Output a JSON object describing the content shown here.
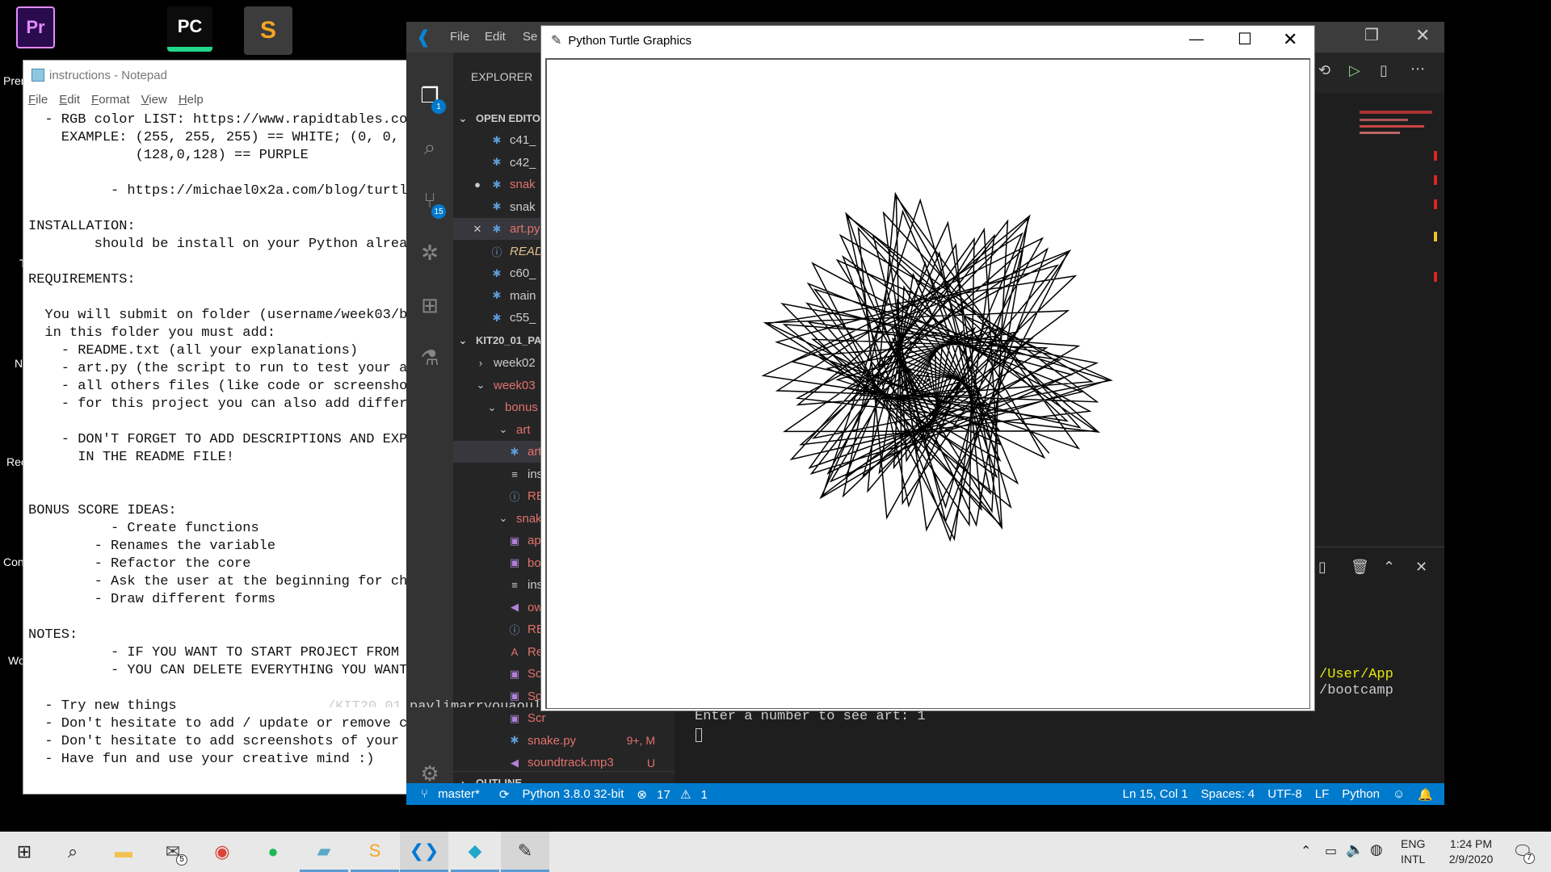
{
  "desktop": {
    "icons": [
      {
        "name": "premiere-icon",
        "glyph": "Pr",
        "color": "#2a0c4e",
        "accent": "#e48bff"
      },
      {
        "name": "pycharm-icon",
        "glyph": "PC",
        "color": "#0c0c0c",
        "accent": "#21d789"
      },
      {
        "name": "sublime-icon",
        "glyph": "S",
        "color": "#f5a623",
        "accent": "#fff"
      }
    ],
    "labels": [
      "Pren",
      "T",
      "N",
      "Rec",
      "Con",
      "Wo"
    ]
  },
  "notepad": {
    "title": "instructions - Notepad",
    "menu": [
      "File",
      "Edit",
      "Format",
      "View",
      "Help"
    ],
    "text": "  - RGB color LIST: https://www.rapidtables.com\n    EXAMPLE: (255, 255, 255) == WHITE; (0, 0, 0\n             (128,0,128) == PURPLE\n\n          - https://michael0x2a.com/blog/turtle-e\n\nINSTALLATION:\n        should be install on your Python alread\n\nREQUIREMENTS:\n\n  You will submit on folder (username/week03/bo\n  in this folder you must add:\n    - README.txt (all your explanations)\n    - art.py (the script to run to test your ap\n    - all others files (like code or screenshot\n    - for this project you can also add differe\n\n    - DON'T FORGET TO ADD DESCRIPTIONS AND EXPL\n      IN THE README FILE!\n\n\nBONUS SCORE IDEAS:\n          - Create functions\n        - Renames the variable\n        - Refactor the core\n        - Ask the user at the beginning for choic\n        - Draw different forms\n\nNOTES:\n          - IF YOU WANT TO START PROJECT FROM SCR\n          - YOU CAN DELETE EVERYTHING YOU WANT.\n\n  - Try new things\n  - Don't hesitate to add / update or remove co\n  - Don't hesitate to add screenshots of your e\n  - Have fun and use your creative mind :)"
  },
  "vscode": {
    "menu": [
      "File",
      "Edit",
      "Se"
    ],
    "explorer_label": "EXPLORER",
    "open_editors_label": "OPEN EDITO",
    "open_editors": [
      {
        "label": "c41_",
        "prefix": "",
        "icon": "python-file-icon",
        "color": "#ccc",
        "italic": false
      },
      {
        "label": "c42_",
        "prefix": "",
        "icon": "python-file-icon",
        "color": "#ccc",
        "italic": false
      },
      {
        "label": "snak",
        "prefix": "●",
        "icon": "python-file-icon",
        "color": "#e2726c",
        "italic": false
      },
      {
        "label": "snak",
        "prefix": "",
        "icon": "python-file-icon",
        "color": "#ccc",
        "italic": false
      },
      {
        "label": "art.py",
        "prefix": "✕",
        "icon": "python-file-icon",
        "color": "#e2726c",
        "italic": false
      },
      {
        "label": "READ",
        "prefix": "",
        "icon": "info-file-icon",
        "color": "#e2c08d",
        "italic": true
      },
      {
        "label": "c60_",
        "prefix": "",
        "icon": "python-file-icon",
        "color": "#ccc",
        "italic": false
      },
      {
        "label": "main",
        "prefix": "",
        "icon": "python-file-icon",
        "color": "#ccc",
        "italic": false
      },
      {
        "label": "c55_",
        "prefix": "",
        "icon": "python-file-icon",
        "color": "#ccc",
        "italic": false
      }
    ],
    "workspace_label": "KIT20_01_PA",
    "tree": [
      {
        "label": "week02",
        "indent": 1,
        "chev": "›",
        "icon": "",
        "color": "#ccc"
      },
      {
        "label": "week03",
        "indent": 1,
        "chev": "⌄",
        "icon": "",
        "color": "#e2726c"
      },
      {
        "label": "bonus",
        "indent": 2,
        "chev": "⌄",
        "icon": "",
        "color": "#e2726c"
      },
      {
        "label": "art",
        "indent": 3,
        "chev": "⌄",
        "icon": "",
        "color": "#e2726c"
      },
      {
        "label": "art.",
        "indent": 4,
        "chev": "",
        "icon": "python-file-icon",
        "color": "#e2726c"
      },
      {
        "label": "inst",
        "indent": 4,
        "chev": "",
        "icon": "text-file-icon",
        "color": "#ccc"
      },
      {
        "label": "RE/",
        "indent": 4,
        "chev": "",
        "icon": "info-file-icon",
        "color": "#e2726c"
      },
      {
        "label": "snak",
        "indent": 3,
        "chev": "⌄",
        "icon": "",
        "color": "#e2726c"
      },
      {
        "label": "app",
        "indent": 4,
        "chev": "",
        "icon": "image-file-icon",
        "color": "#e2726c"
      },
      {
        "label": "bor",
        "indent": 4,
        "chev": "",
        "icon": "image-file-icon",
        "color": "#e2726c"
      },
      {
        "label": "inst",
        "indent": 4,
        "chev": "",
        "icon": "text-file-icon",
        "color": "#ccc"
      },
      {
        "label": "ow",
        "indent": 4,
        "chev": "",
        "icon": "audio-file-icon",
        "color": "#e2726c"
      },
      {
        "label": "RE/",
        "indent": 4,
        "chev": "",
        "icon": "info-file-icon",
        "color": "#e2726c"
      },
      {
        "label": "Ret",
        "indent": 4,
        "chev": "",
        "icon": "font-file-icon",
        "color": "#e2726c"
      },
      {
        "label": "Scr",
        "indent": 4,
        "chev": "",
        "icon": "image-file-icon",
        "color": "#e2726c"
      },
      {
        "label": "Scr",
        "indent": 4,
        "chev": "",
        "icon": "image-file-icon",
        "color": "#e2726c"
      },
      {
        "label": "Scr",
        "indent": 4,
        "chev": "",
        "icon": "image-file-icon",
        "color": "#e2726c"
      },
      {
        "label": "snake.py",
        "indent": 4,
        "chev": "",
        "icon": "python-file-icon",
        "color": "#e2726c",
        "badge": "9+, M"
      },
      {
        "label": "soundtrack.mp3",
        "indent": 4,
        "chev": "",
        "icon": "audio-file-icon",
        "color": "#e2726c",
        "badge": "U"
      }
    ],
    "outline_label": "OUTLINE",
    "badges": {
      "explorer": "1",
      "scm": "15"
    },
    "terminal": {
      "line1": "/User/App",
      "line2": "/bootcamp",
      "line3": "/KIT20_01_pavlimarryouaoulli15/pavlimarryouaoulli15/weeks03/bonus/art/art.py",
      "prompt": "Enter a number to see art: 1"
    },
    "status": {
      "branch": "master*",
      "python": "Python 3.8.0 32-bit",
      "errors": "17",
      "warnings": "1",
      "position": "Ln 15, Col 1",
      "spaces": "Spaces: 4",
      "encoding": "UTF-8",
      "eol": "LF",
      "language": "Python"
    }
  },
  "turtle": {
    "title": "Python Turtle Graphics"
  },
  "taskbar": {
    "apps": [
      {
        "name": "start-button",
        "glyph": "⊞",
        "color": "#222"
      },
      {
        "name": "search-button",
        "glyph": "⌕",
        "color": "#222"
      },
      {
        "name": "file-explorer-icon",
        "glyph": "▬",
        "color": "#f2c14e"
      },
      {
        "name": "mail-icon",
        "glyph": "✉",
        "color": "#444",
        "badge": "5"
      },
      {
        "name": "chrome-icon",
        "glyph": "◉",
        "color": "#db4437"
      },
      {
        "name": "spotify-icon",
        "glyph": "●",
        "color": "#1db954"
      },
      {
        "name": "notepad-icon",
        "glyph": "▰",
        "color": "#5aa9c9"
      },
      {
        "name": "sublime-taskbar-icon",
        "glyph": "S",
        "color": "#f5a623"
      },
      {
        "name": "vscode-taskbar-icon",
        "glyph": "❮❯",
        "color": "#0078d4"
      },
      {
        "name": "gitkraken-icon",
        "glyph": "◆",
        "color": "#21a7c7"
      },
      {
        "name": "python-turtle-taskbar-icon",
        "glyph": "✎",
        "color": "#333"
      }
    ],
    "lang1": "ENG",
    "lang2": "INTL",
    "time": "1:24 PM",
    "date": "2/9/2020",
    "notif": "7"
  }
}
